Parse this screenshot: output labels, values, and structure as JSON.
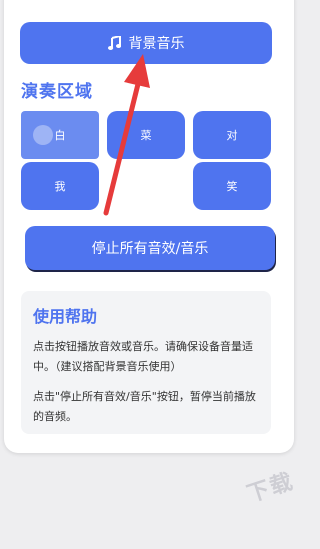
{
  "bgm_button": {
    "label": "背景音乐",
    "icon": "music-note-icon"
  },
  "section_title": "演奏区域",
  "pads": [
    {
      "label": "白",
      "active": true
    },
    {
      "label": "菜",
      "active": false
    },
    {
      "label": "对",
      "active": false
    },
    {
      "label": "我",
      "active": false
    },
    {
      "label": "笑",
      "active": false
    }
  ],
  "stop_button": {
    "label": "停止所有音效/音乐"
  },
  "help": {
    "title": "使用帮助",
    "p1": "点击按钮播放音效或音乐。请确保设备音量适中。（建议搭配背景音乐使用）",
    "p2": "点击\"停止所有音效/音乐\"按钮，暂停当前播放的音频。"
  },
  "colors": {
    "accent": "#4f74ef",
    "annotation_arrow": "#e63b3b"
  }
}
